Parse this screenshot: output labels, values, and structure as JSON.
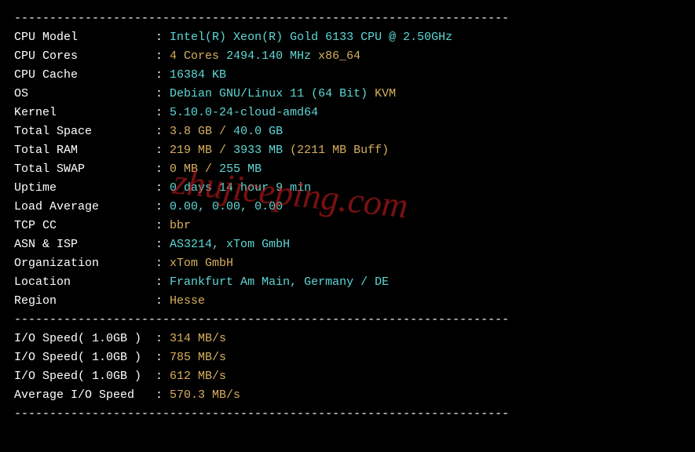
{
  "divider": "----------------------------------------------------------------------",
  "watermark": "zhujiceping.com",
  "rows": [
    {
      "label": "CPU Model",
      "parts": [
        {
          "cls": "cyan",
          "text": "Intel(R) Xeon(R) Gold 6133 CPU @ 2.50GHz"
        }
      ]
    },
    {
      "label": "CPU Cores",
      "parts": [
        {
          "cls": "yellow",
          "text": "4 Cores"
        },
        {
          "cls": "cyan",
          "text": " 2494.140 MHz "
        },
        {
          "cls": "yellow",
          "text": "x86_64"
        }
      ]
    },
    {
      "label": "CPU Cache",
      "parts": [
        {
          "cls": "cyan",
          "text": "16384 KB"
        }
      ]
    },
    {
      "label": "OS",
      "parts": [
        {
          "cls": "cyan",
          "text": "Debian GNU/Linux 11 (64 Bit) "
        },
        {
          "cls": "yellow",
          "text": "KVM"
        }
      ]
    },
    {
      "label": "Kernel",
      "parts": [
        {
          "cls": "cyan",
          "text": "5.10.0-24-cloud-amd64"
        }
      ]
    },
    {
      "label": "Total Space",
      "parts": [
        {
          "cls": "yellow",
          "text": "3.8 GB / "
        },
        {
          "cls": "cyan",
          "text": "40.0 GB"
        }
      ]
    },
    {
      "label": "Total RAM",
      "parts": [
        {
          "cls": "yellow",
          "text": "219 MB / "
        },
        {
          "cls": "cyan",
          "text": "3933 MB "
        },
        {
          "cls": "yellow",
          "text": "(2211 MB Buff)"
        }
      ]
    },
    {
      "label": "Total SWAP",
      "parts": [
        {
          "cls": "yellow",
          "text": "0 MB / "
        },
        {
          "cls": "cyan",
          "text": "255 MB"
        }
      ]
    },
    {
      "label": "Uptime",
      "parts": [
        {
          "cls": "cyan",
          "text": "0 days 14 hour 9 min"
        }
      ]
    },
    {
      "label": "Load Average",
      "parts": [
        {
          "cls": "cyan",
          "text": "0.00, 0.00, 0.00"
        }
      ]
    },
    {
      "label": "TCP CC",
      "parts": [
        {
          "cls": "yellow",
          "text": "bbr"
        }
      ]
    },
    {
      "label": "ASN & ISP",
      "parts": [
        {
          "cls": "cyan",
          "text": "AS3214, xTom GmbH"
        }
      ]
    },
    {
      "label": "Organization",
      "parts": [
        {
          "cls": "yellow",
          "text": "xTom GmbH"
        }
      ]
    },
    {
      "label": "Location",
      "parts": [
        {
          "cls": "cyan",
          "text": "Frankfurt Am Main, Germany / DE"
        }
      ]
    },
    {
      "label": "Region",
      "parts": [
        {
          "cls": "yellow",
          "text": "Hesse"
        }
      ]
    }
  ],
  "io_rows": [
    {
      "label": "I/O Speed( 1.0GB )",
      "parts": [
        {
          "cls": "yellow",
          "text": "314 MB/s"
        }
      ]
    },
    {
      "label": "I/O Speed( 1.0GB )",
      "parts": [
        {
          "cls": "yellow",
          "text": "785 MB/s"
        }
      ]
    },
    {
      "label": "I/O Speed( 1.0GB )",
      "parts": [
        {
          "cls": "yellow",
          "text": "612 MB/s"
        }
      ]
    },
    {
      "label": "Average I/O Speed",
      "parts": [
        {
          "cls": "yellow",
          "text": "570.3 MB/s"
        }
      ]
    }
  ]
}
